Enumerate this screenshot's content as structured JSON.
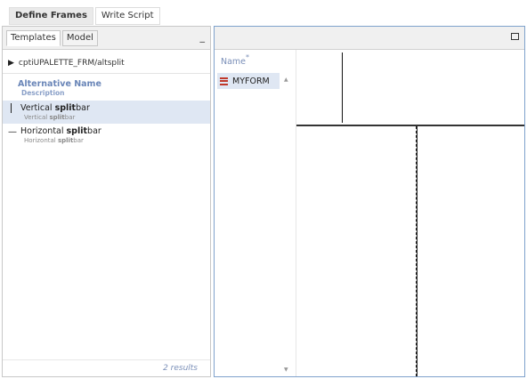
{
  "top_tabs": [
    {
      "label": "Define Frames"
    },
    {
      "label": "Write Script"
    }
  ],
  "left_panel": {
    "tabs": [
      {
        "label": "Templates"
      },
      {
        "label": "Model"
      }
    ],
    "minimize_label": "_",
    "path": "cptiUPALETTE_FRM/altsplit",
    "columns": {
      "alternative_name": "Alternative Name",
      "description": "Description"
    },
    "items": [
      {
        "name_pre": "Vertical ",
        "name_bold": "split",
        "name_post": "bar",
        "sub_pre": "Vertical ",
        "sub_bold": "split",
        "sub_post": "bar"
      },
      {
        "name_pre": "Horizontal ",
        "name_bold": "split",
        "name_post": "bar",
        "sub_pre": "Horizontal ",
        "sub_bold": "split",
        "sub_post": "bar"
      }
    ],
    "results": "2 results"
  },
  "right_panel": {
    "name_header": "Name",
    "name_marker": "*",
    "forms": [
      {
        "label": "MYFORM"
      }
    ]
  },
  "colors": {
    "accent": "#6a86b8",
    "selection": "#dfe7f3",
    "panel_border": "#7fa2cc",
    "form_icon": "#c0392b"
  }
}
